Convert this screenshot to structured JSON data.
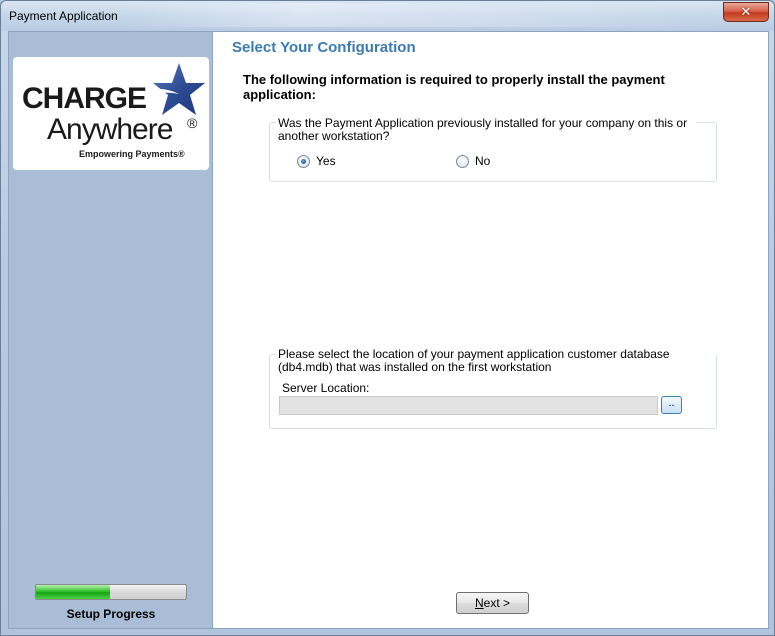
{
  "window": {
    "title": "Payment Application",
    "close_glyph": "✕"
  },
  "sidebar": {
    "logo": {
      "line1": "CHARGE",
      "line2": "Anywhere",
      "registered": "®",
      "tagline": "Empowering Payments®",
      "star_icon": "star-icon"
    },
    "progress": {
      "fraction": 0.49,
      "label": "Setup Progress"
    }
  },
  "main": {
    "heading": "Select Your Configuration",
    "intro": "The following information is required to properly install the payment application:",
    "installed_group": {
      "question": "Was the Payment Application previously installed for your company on this or another workstation?",
      "options": [
        {
          "label": "Yes",
          "checked": true
        },
        {
          "label": "No",
          "checked": false
        }
      ]
    },
    "location_group": {
      "prompt": "Please select the location of your payment application customer database (db4.mdb) that was installed on the first workstation",
      "server_label": "Server Location:",
      "server_value": "",
      "browse_label": ".."
    },
    "next_button": {
      "accel": "N",
      "rest": "ext >"
    }
  }
}
